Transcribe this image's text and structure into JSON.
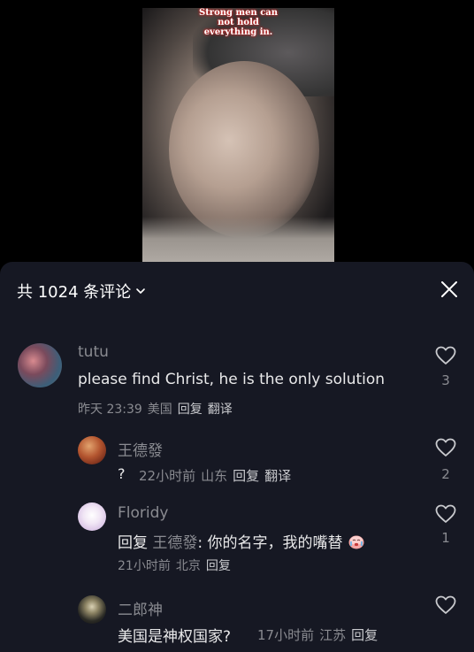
{
  "video": {
    "caption_lines": [
      "Strong men can",
      "not hold",
      "everything in."
    ]
  },
  "sheet": {
    "title": "共 1024 条评论",
    "chevron_icon": "chevron-down-icon",
    "close_icon": "close-icon"
  },
  "comments": [
    {
      "username": "tutu",
      "text": "please find Christ,  he is the only solution",
      "time": "昨天 23:39",
      "location": "美国",
      "reply_label": "回复",
      "translate_label": "翻译",
      "likes": "3"
    },
    {
      "username": "王德發",
      "text": "?",
      "time": "22小时前",
      "location": "山东",
      "reply_label": "回复",
      "translate_label": "翻译",
      "likes": "2"
    },
    {
      "username": "Floridy",
      "reply_prefix": "回复",
      "reply_target": "王德發",
      "text": ": 你的名字，我的嘴替",
      "time": "21小时前",
      "location": "北京",
      "reply_label": "回复",
      "likes": "1"
    },
    {
      "username": "二郎神",
      "text": "美国是神权国家?",
      "time": "17小时前",
      "location": "江苏",
      "reply_label": "回复"
    }
  ]
}
